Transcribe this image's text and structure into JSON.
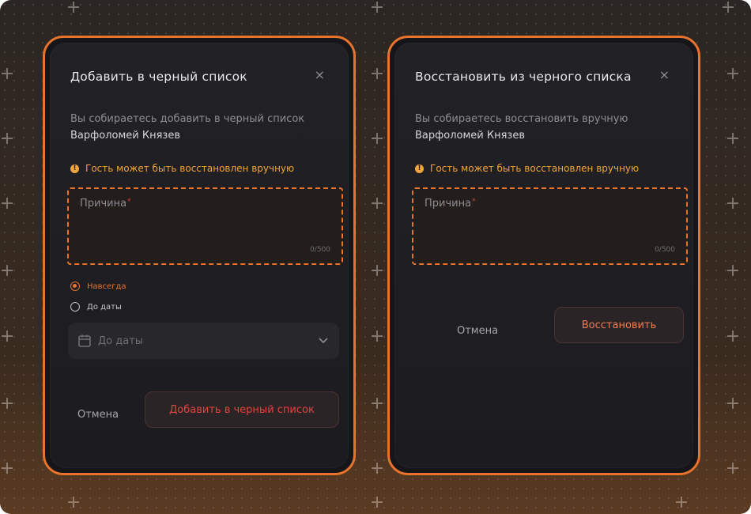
{
  "left_modal": {
    "title": "Добавить в черный список",
    "close": "×",
    "desc_prefix": "Вы собираетесь добавить в черный список ",
    "guest_name": "Варфоломей Князев",
    "warning": "Гость может быть восстановлен вручную",
    "warning_icon": "!",
    "reason_label": "Причина",
    "required_mark": "*",
    "counter": "0/500",
    "option_forever": "Навсегда",
    "option_until_date": "До даты",
    "date_placeholder": "До даты",
    "cancel_label": "Отмена",
    "submit_label": "Добавить в черный список"
  },
  "right_modal": {
    "title": "Восстановить из черного списка",
    "close": "×",
    "desc_prefix": "Вы собираетесь восстановить вручную ",
    "guest_name": "Варфоломей Князев",
    "warning": "Гость может быть восстановлен вручную",
    "warning_icon": "!",
    "reason_label": "Причина",
    "required_mark": "*",
    "counter": "0/500",
    "cancel_label": "Отмена",
    "submit_label": "Восстановить"
  },
  "colors": {
    "accent": "#e8732b",
    "warning": "#f0a43a",
    "danger": "#e2443f",
    "restore": "#ef7c55"
  }
}
